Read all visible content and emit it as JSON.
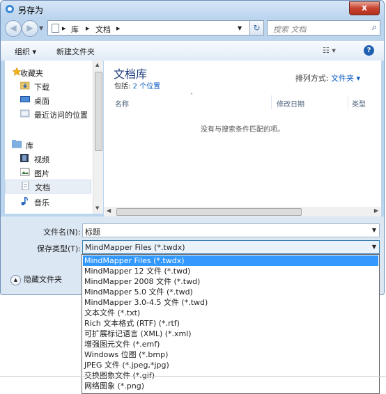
{
  "window": {
    "title": "另存为",
    "close_label": "x"
  },
  "nav": {
    "back_icon": "back-arrow-icon",
    "forward_icon": "forward-arrow-icon",
    "breadcrumb": [
      "库",
      "文档"
    ],
    "search_placeholder": "搜索 文档"
  },
  "toolbar": {
    "organize": "组织 ▾",
    "new_folder": "新建文件夹",
    "view_label": "☷ ▾",
    "help": "?"
  },
  "sidebar": {
    "favorites": [
      {
        "label": "收藏夹",
        "icon": "star-icon"
      },
      {
        "label": "下载",
        "icon": "download-folder-icon"
      },
      {
        "label": "桌面",
        "icon": "desktop-icon"
      },
      {
        "label": "最近访问的位置",
        "icon": "recent-places-icon"
      }
    ],
    "libraries": [
      {
        "label": "库",
        "icon": "library-icon"
      },
      {
        "label": "视频",
        "icon": "video-icon"
      },
      {
        "label": "图片",
        "icon": "pictures-icon"
      },
      {
        "label": "文档",
        "icon": "documents-icon"
      },
      {
        "label": "音乐",
        "icon": "music-icon"
      }
    ]
  },
  "main": {
    "title": "文档库",
    "includes_prefix": "包括: ",
    "includes_link": "2 个位置",
    "arrange_label": "排列方式: ",
    "arrange_value": "文件夹 ▾",
    "columns": [
      "名称",
      "修改日期",
      "类型"
    ],
    "empty_message": "没有与搜索条件匹配的项。"
  },
  "form": {
    "filename_label": "文件名(N):",
    "filename_value": "标题",
    "savetype_label": "保存类型(T):",
    "savetype_value": "MindMapper Files (*.twdx)",
    "hide_folders": "隐藏文件夹"
  },
  "dropdown_options": [
    "MindMapper Files (*.twdx)",
    "MindMapper 12 文件 (*.twd)",
    "MindMapper 2008 文件 (*.twd)",
    "MindMapper 5.0 文件 (*.twd)",
    "MindMapper 3.0-4.5 文件 (*.twd)",
    "文本文件 (*.txt)",
    "Rich 文本格式 (RTF) (*.rtf)",
    "可扩展标记语言 (XML) (*.xml)",
    "增强图元文件 (*.emf)",
    "Windows 位图 (*.bmp)",
    "JPEG 文件 (*.jpeg,*jpg)",
    "交换图象文件 (*.gif)",
    "网络图象 (*.png)"
  ],
  "colors": {
    "selection": "#3399ff",
    "link": "#0a5bc4",
    "frame": "#bcd5ef"
  }
}
